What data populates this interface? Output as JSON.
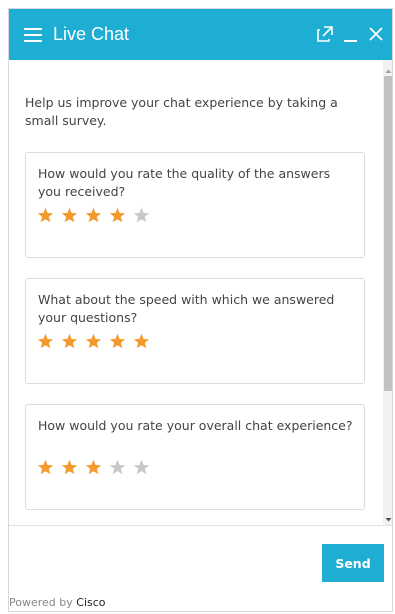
{
  "header": {
    "title": "Live Chat",
    "background_color": "#1eaed4",
    "icons": [
      "hamburger-menu-icon",
      "popout-icon",
      "minimize-icon",
      "close-icon"
    ]
  },
  "survey": {
    "intro": "Help us improve your chat experience by taking a small survey.",
    "star_filled_color": "#f29a2e",
    "star_empty_color": "#c8c8c8",
    "questions": [
      {
        "text": "How would you rate the quality of the answers you received?",
        "rating": 4,
        "max": 5
      },
      {
        "text": "What about the speed with which we answered your questions?",
        "rating": 5,
        "max": 5
      },
      {
        "text": "How would you rate your overall chat experience?",
        "rating": 3,
        "max": 5
      }
    ]
  },
  "footer": {
    "send_label": "Send",
    "powered_prefix": "Powered by",
    "powered_brand": "Cisco"
  }
}
